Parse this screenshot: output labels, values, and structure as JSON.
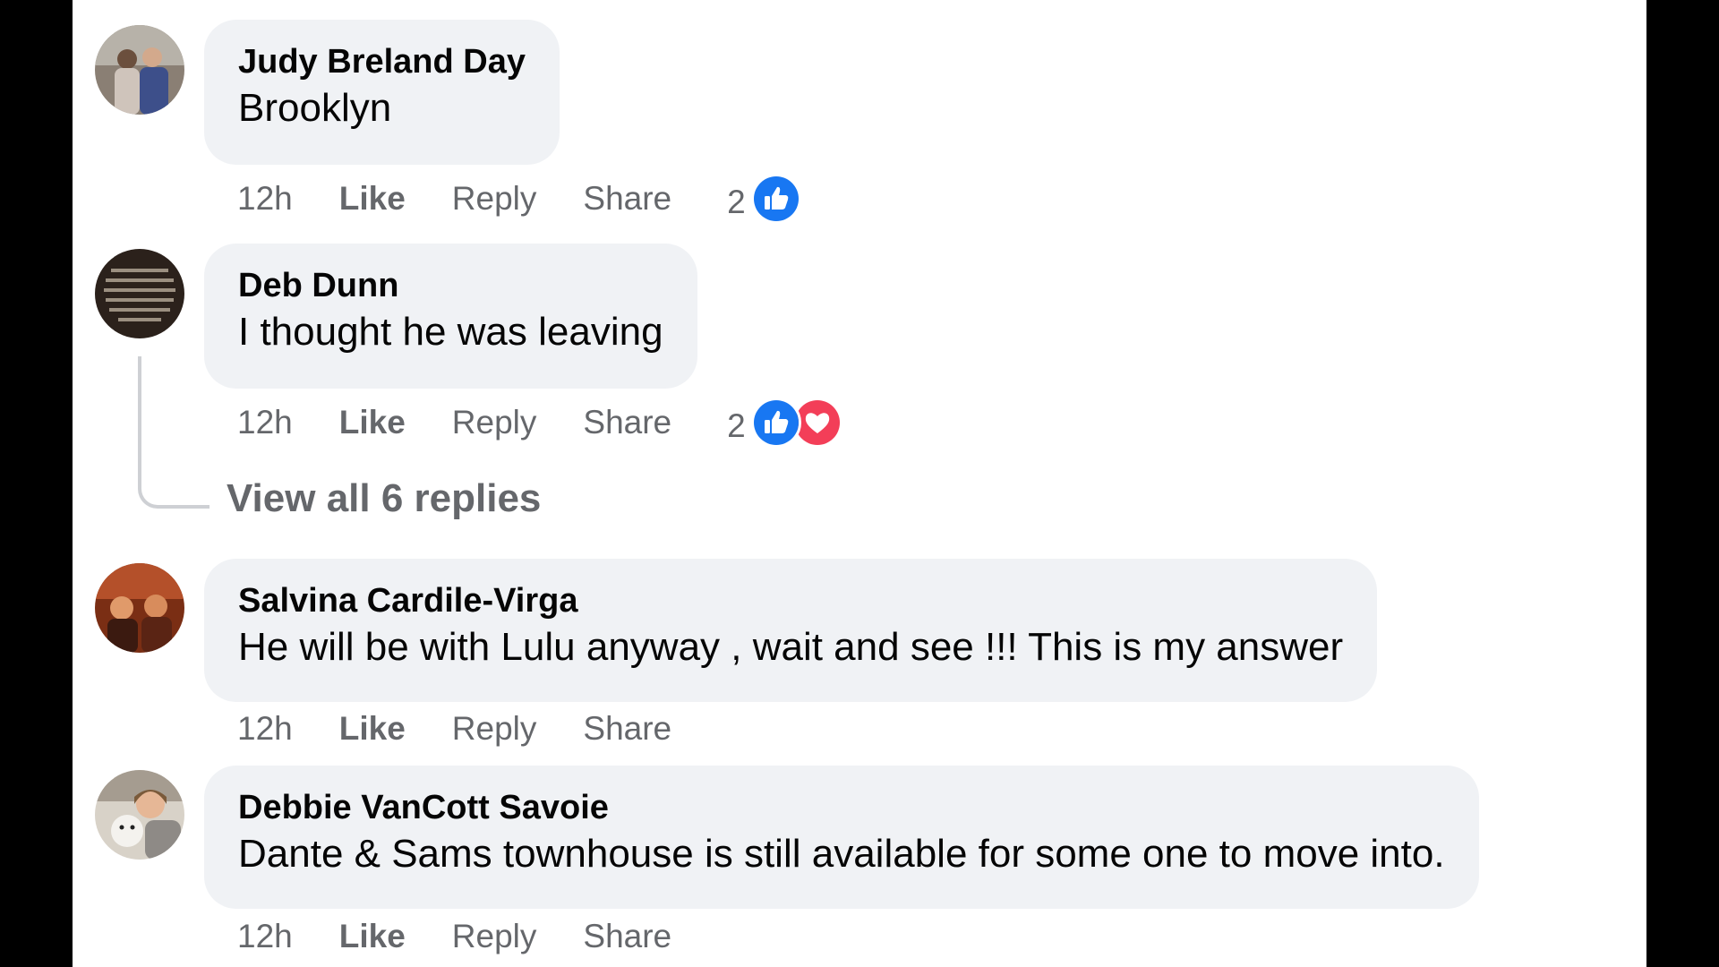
{
  "comments": [
    {
      "author": "Judy Breland Day",
      "text": "Brooklyn",
      "time": "12h",
      "like_label": "Like",
      "reply_label": "Reply",
      "share_label": "Share",
      "reaction_count": "2",
      "reactions": [
        "like-icon"
      ]
    },
    {
      "author": "Deb Dunn",
      "text": "I thought he was leaving",
      "time": "12h",
      "like_label": "Like",
      "reply_label": "Reply",
      "share_label": "Share",
      "reaction_count": "2",
      "reactions": [
        "like-icon",
        "love-icon"
      ]
    },
    {
      "author": "Salvina Cardile-Virga",
      "text": "He will be with Lulu anyway , wait and see !!! This is my answer",
      "time": "12h",
      "like_label": "Like",
      "reply_label": "Reply",
      "share_label": "Share"
    },
    {
      "author": "Debbie VanCott Savoie",
      "text": "Dante & Sams townhouse is still available for some one to move into.",
      "time": "12h",
      "like_label": "Like",
      "reply_label": "Reply",
      "share_label": "Share"
    }
  ],
  "view_replies_label": "View all 6 replies",
  "colors": {
    "bubble": "#f0f2f5",
    "like_blue": "#1877f2",
    "love_red": "#f33e58",
    "meta_gray": "#65676b"
  }
}
